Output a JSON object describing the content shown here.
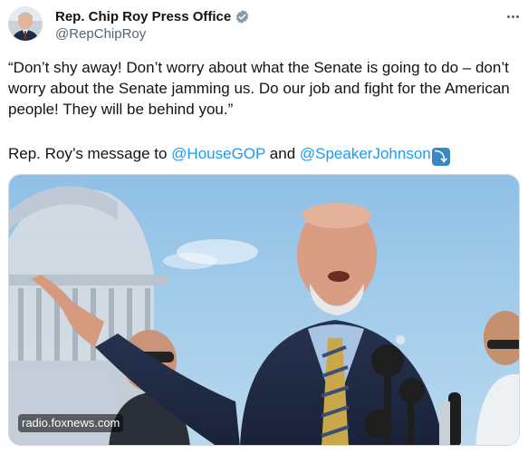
{
  "author": {
    "display_name": "Rep. Chip Roy Press Office",
    "handle": "@RepChipRoy",
    "verified": true,
    "avatar_icon": "avatar-photo"
  },
  "tweet": {
    "quote": "“Don’t shy away! Don’t worry about what the Senate is going to do – don’t worry about the Senate jamming us. Do our job and fight for the American people! They will be behind you.”",
    "message_prefix": "Rep. Roy’s message to ",
    "mention_1": "@HouseGOP",
    "message_and": " and ",
    "mention_2": "@SpeakerJohnson",
    "arrow_emoji": "⤵"
  },
  "media": {
    "source_label": "radio.foxnews.com"
  },
  "colors": {
    "link": "#1d9bf0",
    "text": "#0f1419",
    "secondary": "#536471",
    "verified": "#829aab"
  },
  "icons": {
    "more": "more-dots-icon",
    "verified": "verified-badge-icon",
    "arrow": "arrow-down-right-emoji-icon"
  }
}
